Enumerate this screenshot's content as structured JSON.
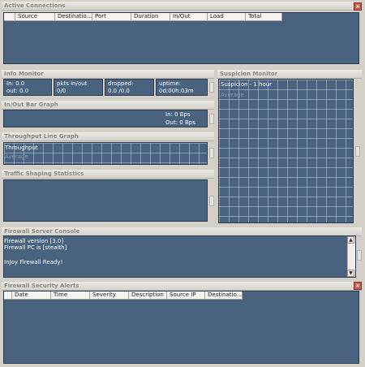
{
  "active_connections": {
    "title": "Active Connections",
    "columns": [
      "Source",
      "Destinatio...",
      "Port",
      "Duration",
      "In/Out",
      "Load",
      "Total"
    ]
  },
  "info_monitor": {
    "title": "Info Monitor",
    "in": "In: 0.0",
    "out": "out: 0.0",
    "pkts_label": "pkts in/out",
    "pkts_value": "0/0",
    "dropped_label": "dropped:",
    "dropped_value": "0.0 /0.0",
    "uptime_label": "uptime:",
    "uptime_value": "0d:00h:03m"
  },
  "suspicion_monitor": {
    "title": "Suspicion Monitor",
    "label": "Suspicion - 1 hour",
    "average": "Average"
  },
  "inout_bar_graph": {
    "title": "In/Out Bar Graph",
    "in": "In: 0 Bps",
    "out": "Out: 0 Bps"
  },
  "throughput_line_graph": {
    "title": "Throughput Line Graph",
    "label": "Throughput",
    "average": "Average"
  },
  "traffic_shaping": {
    "title": "Traffic Shaping Statistics"
  },
  "firewall_console": {
    "title": "Firewall Server Console",
    "lines": [
      "Firewall version [3.0]",
      "Firewall PC is [stealth]",
      "",
      "InJoy Firewall Ready!"
    ]
  },
  "security_alerts": {
    "title": "Firewall Security Alerts",
    "columns": [
      "Date",
      "Time",
      "Severity",
      "Description",
      "Source IP",
      "Destinatio..."
    ]
  },
  "icons": {
    "close": "close-icon",
    "scroll_up": "arrow-up-icon",
    "scroll_down": "arrow-down-icon"
  },
  "colors": {
    "panel_blue": "#48627f",
    "window_bg": "#d4d0c8",
    "close_red": "#c6584c"
  }
}
